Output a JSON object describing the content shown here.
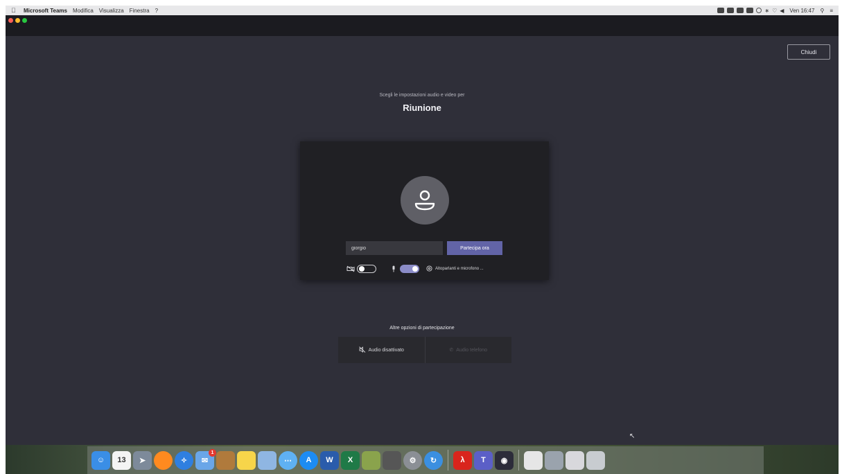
{
  "menubar": {
    "app_name": "Microsoft Teams",
    "menus": [
      "Modifica",
      "Visualizza",
      "Finestra",
      "?"
    ],
    "clock": "Ven 16:47"
  },
  "main": {
    "close_label": "Chiudi",
    "subtitle": "Scegli le impostazioni audio e video per",
    "title": "Riunione"
  },
  "card": {
    "name_value": "giorgio",
    "join_label": "Partecipa ora",
    "camera_on": false,
    "mic_on": true,
    "audio_settings_label": "Altoparlanti e microfono ..."
  },
  "other_options": {
    "title": "Altre opzioni di partecipazione",
    "audio_off_label": "Audio disattivato",
    "phone_audio_label": "Audio telefono"
  },
  "dock": {
    "calendar_day": "13",
    "badge_count": "1",
    "icons": [
      {
        "name": "finder-icon",
        "color": "#3a8ee6"
      },
      {
        "name": "calendar-icon",
        "color": "#f4f4f4"
      },
      {
        "name": "launchpad-icon",
        "color": "#7d8a9a"
      },
      {
        "name": "firefox-icon",
        "color": "#ff8a1f"
      },
      {
        "name": "safari-icon",
        "color": "#2f7fe0"
      },
      {
        "name": "mail-icon",
        "color": "#6aa6e8"
      },
      {
        "name": "contacts-icon",
        "color": "#b07a3c"
      },
      {
        "name": "notes-icon",
        "color": "#f7d54a"
      },
      {
        "name": "preview-icon",
        "color": "#8fb6e2"
      },
      {
        "name": "messages-icon",
        "color": "#5fb1f3"
      },
      {
        "name": "app-store-icon",
        "color": "#1d8cf2"
      },
      {
        "name": "word-icon",
        "color": "#2a5cab"
      },
      {
        "name": "excel-icon",
        "color": "#1f7a47"
      },
      {
        "name": "utility-icon",
        "color": "#8aa34c"
      },
      {
        "name": "calculator-icon",
        "color": "#565656"
      },
      {
        "name": "system-preferences-icon",
        "color": "#8b8f95"
      },
      {
        "name": "sync-icon",
        "color": "#3b8fe0"
      },
      {
        "name": "acrobat-icon",
        "color": "#d9251c"
      },
      {
        "name": "teams-icon",
        "color": "#5b5fc7"
      },
      {
        "name": "obs-icon",
        "color": "#2c2c3a"
      },
      {
        "name": "document-icon",
        "color": "#e6e6e6"
      },
      {
        "name": "drive-utility-icon",
        "color": "#9aa3ad"
      },
      {
        "name": "downloads-icon",
        "color": "#d8d8dc"
      },
      {
        "name": "trash-icon",
        "color": "#c8ccd0"
      }
    ]
  }
}
